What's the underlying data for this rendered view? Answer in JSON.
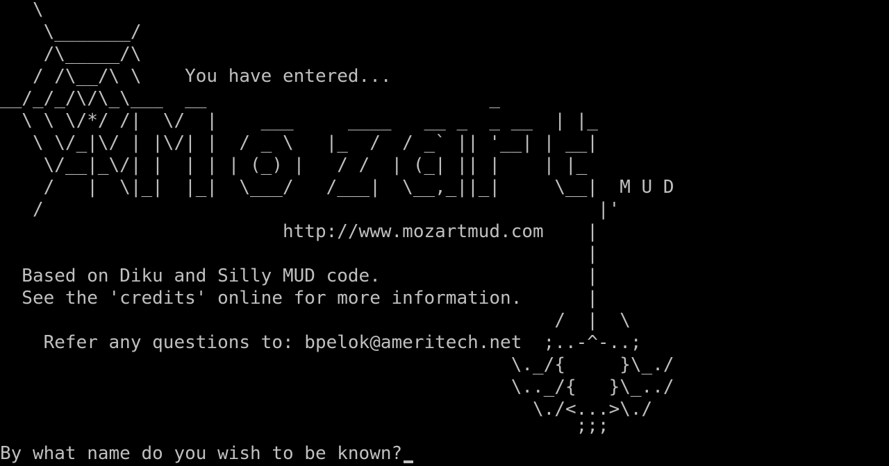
{
  "screen": {
    "background": "#000000",
    "foreground": "#c0c0c0"
  },
  "lines": [
    "   \\",
    "    \\_______/",
    "    /\\_____/\\",
    "   / /\\__/\\ \\    You have entered...",
    "__/_/_/\\/\\_\\___  __                          _",
    "  \\ \\ \\/*/ /|  \\/  |    ___     ____   __ _  _ __  | |_",
    "   \\ \\/_|\\/ | |\\/| |  / _ \\   |_  /  / _` || '__| | __|",
    "    \\/__|_\\/| |  | | | (_) |   / /  | (_| || |    | |_",
    "    /   |  \\|_|  |_|  \\___/   /___|  \\__,_||_|     \\__|  M U D",
    "   /                                                   |'",
    "                          http://www.mozartmud.com    |",
    "                                                      |",
    "  Based on Diku and Silly MUD code.                   |",
    "  See the 'credits' online for more information.      |",
    "                                                   /  |  \\",
    "    Refer any questions to: bpelok@ameritech.net  ;..-^-..;",
    "                                               \\._/{     }\\_./",
    "                                               \\.._/{   }\\_../",
    "                                                 \\./<...>\\./",
    "                                                     ;;;"
  ],
  "prompt": {
    "text": "By what name do you wish to be known?"
  }
}
